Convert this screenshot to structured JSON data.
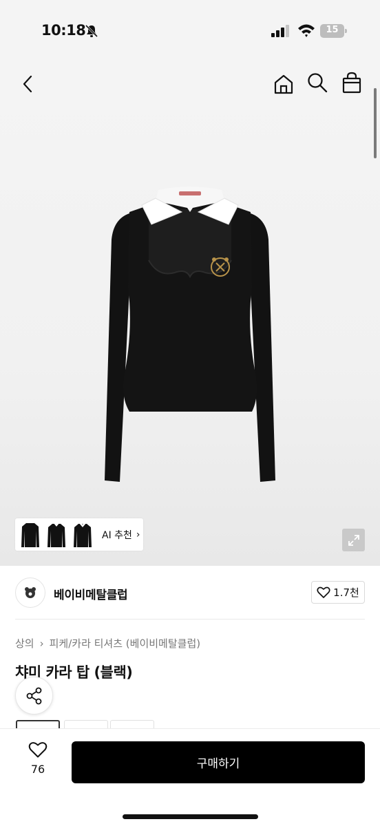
{
  "status": {
    "time": "10:18",
    "battery": "15"
  },
  "nav": {
    "back_icon": "chevron-left-icon",
    "home_icon": "home-icon",
    "search_icon": "search-icon",
    "cart_icon": "shopping-bag-icon"
  },
  "hero": {
    "ai_recommend_label": "AI 추천",
    "ai_chevron": "›"
  },
  "brand": {
    "name": "베이비메탈클럽",
    "like_count": "1.7천"
  },
  "product": {
    "breadcrumb": [
      "상의",
      "피케/카라 티셔츠 (베이비메탈클럽)"
    ],
    "breadcrumb_sep": "›",
    "title": "챠미 카라 탑 (블랙)"
  },
  "bottom": {
    "wish_count": "76",
    "buy_label": "구매하기"
  },
  "colors": {
    "buy_button": "#000000",
    "zoom_button": "#c9c9c9"
  }
}
